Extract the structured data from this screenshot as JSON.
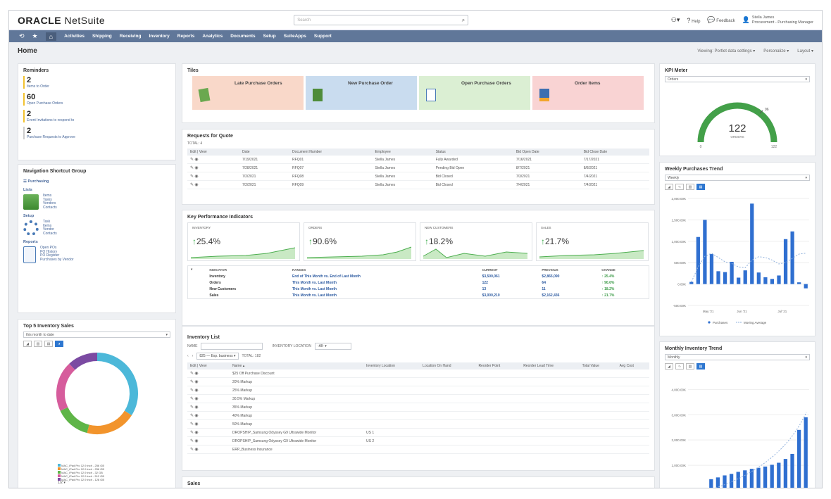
{
  "header": {
    "logo_brand": "ORACLE",
    "logo_product": "NetSuite",
    "search_placeholder": "Search",
    "help_label": "Help",
    "feedback_label": "Feedback",
    "user_name": "Stella James",
    "user_role": "Procurement - Purchasing Manager"
  },
  "nav": {
    "items": [
      "Activities",
      "Shipping",
      "Receiving",
      "Inventory",
      "Reports",
      "Analytics",
      "Documents",
      "Setup",
      "SuiteApps",
      "Support"
    ]
  },
  "page": {
    "title": "Home",
    "viewing": "Viewing: Portlet data settings ▾",
    "personalize": "Personalize ▾",
    "layout": "Layout ▾"
  },
  "reminders": {
    "title": "Reminders",
    "items": [
      {
        "count": "2",
        "label": "Items to Order"
      },
      {
        "count": "60",
        "label": "Open Purchase Orders"
      },
      {
        "count": "2",
        "label": "Event Invitations to respond to"
      },
      {
        "count": "2",
        "label": "Purchase Requests to Approve"
      }
    ]
  },
  "navgroup": {
    "title": "Navigation Shortcut Group",
    "group_label": "Purchasing",
    "sections": [
      {
        "name": "Lists",
        "links": [
          "Items",
          "Tasks",
          "Vendors",
          "Contacts"
        ]
      },
      {
        "name": "Setup",
        "links": [
          "Task",
          "Items",
          "Vendor",
          "Contacts"
        ]
      },
      {
        "name": "Reports",
        "links": [
          "Open POs",
          "PO History",
          "PO Register",
          "Purchases by Vendor"
        ]
      }
    ]
  },
  "top5": {
    "title": "Top 5 Inventory Sales",
    "period": "this month to date",
    "legend": [
      "MAC_iPad Pro 12.9 inch - 256 GB",
      "MAC_iPad Pro 12.9 inch - 256 GB",
      "MAC_iPad Pro 12.9 inch - 32 GB",
      "MAC_iPad Pro 12.9 inch - 512 GB",
      "MAC_iPad Pro 12.9 inch - 128 GB"
    ],
    "pager": "1/2 ▾",
    "colors": [
      "#4cb8d9",
      "#f2942c",
      "#5fb548",
      "#d65c9c",
      "#7b4aa2"
    ]
  },
  "tiles": {
    "title": "Tiles",
    "items": [
      {
        "label": "Late Purchase Orders",
        "bg": "#f9d8c9"
      },
      {
        "label": "New Purchase Order",
        "bg": "#c9dcef"
      },
      {
        "label": "Open Purchase Orders",
        "bg": "#dbefd3"
      },
      {
        "label": "Order Items",
        "bg": "#f9d3d3"
      }
    ]
  },
  "rfq": {
    "title": "Requests for Quote",
    "total": "TOTAL: 4",
    "columns": [
      "Edit | View",
      "Date",
      "Document Number",
      "Employee",
      "Status",
      "Bid Open Date",
      "Bid Close Date"
    ],
    "rows": [
      [
        "7/19/2021",
        "RFQ01",
        "Stella James",
        "Fully Awarded",
        "7/16/2021",
        "7/17/2021"
      ],
      [
        "7/28/2021",
        "RFQ07",
        "Stella James",
        "Pending Bid Open",
        "8/7/2021",
        "8/8/2021"
      ],
      [
        "7/2/2021",
        "RFQ08",
        "Stella James",
        "Bid Closed",
        "7/3/2021",
        "7/4/2021"
      ],
      [
        "7/2/2021",
        "RFQ09",
        "Stella James",
        "Bid Closed",
        "7/4/2021",
        "7/4/2021"
      ]
    ]
  },
  "kpi": {
    "title": "Key Performance Indicators",
    "cards": [
      {
        "label": "INVENTORY",
        "value": "25.4%"
      },
      {
        "label": "ORDERS",
        "value": "90.6%"
      },
      {
        "label": "NEW CUSTOMERS",
        "value": "18.2%"
      },
      {
        "label": "SALES",
        "value": "21.7%"
      }
    ],
    "columns": [
      "INDICATOR",
      "RANGES",
      "CURRENT",
      "PREVIOUS",
      "CHANGE"
    ],
    "rows": [
      [
        "Inventory",
        "End of This Month vs. End of Last Month",
        "$3,500,061",
        "$2,865,090",
        "25.4%"
      ],
      [
        "Orders",
        "This Month vs. Last Month",
        "122",
        "64",
        "90.6%"
      ],
      [
        "New Customers",
        "This Month vs. Last Month",
        "13",
        "11",
        "18.2%"
      ],
      [
        "Sales",
        "This Month vs. Last Month",
        "$3,000,210",
        "$2,162,436",
        "21.7%"
      ]
    ]
  },
  "inventory": {
    "title": "Inventory List",
    "name_label": "NAME",
    "location_label": "INVENTORY LOCATION",
    "location_value": "-All-",
    "range": "825 — Exp. business ▾",
    "total": "TOTAL: 182",
    "columns": [
      "Edit | View",
      "Name ▴",
      "Inventory Location",
      "Location On Hand",
      "Reorder Point",
      "Reorder Lead Time",
      "Total Value",
      "Avg Cost"
    ],
    "rows": [
      [
        "$25 Off Purchase Discount",
        ""
      ],
      [
        "20% Markup",
        ""
      ],
      [
        "25% Markup",
        ""
      ],
      [
        "30.5% Markup",
        ""
      ],
      [
        "35% Markup",
        ""
      ],
      [
        "40% Markup",
        ""
      ],
      [
        "50% Markup",
        ""
      ],
      [
        "DROPSHIP_Samsung Odyssey G9 Ultrawide Monitor",
        "US 1"
      ],
      [
        "DROPSHIP_Samsung Odyssey G9 Ultrawide Monitor",
        "US 2"
      ],
      [
        "ERP_Business Insurance",
        ""
      ]
    ]
  },
  "sales": {
    "title": "Sales"
  },
  "kpimeter": {
    "title": "KPI Meter",
    "select": "Orders",
    "value": "122",
    "unit": "ORDERS",
    "min": "0",
    "max": "122",
    "target": "96"
  },
  "weekly": {
    "title": "Weekly Purchases Trend",
    "select": "Weekly",
    "legend_purchases": "Purchases",
    "legend_moving": "Moving Average",
    "yticks": [
      "2,000.00K",
      "1,500.00K",
      "1,000.00K",
      "500.00K",
      "0.00K",
      "-500.00K"
    ],
    "xticks": [
      "May '21",
      "Jun '21",
      "Jul '21"
    ]
  },
  "monthly": {
    "title": "Monthly Inventory Trend",
    "select": "Monthly",
    "yticks": [
      "4,000.00K",
      "3,000.00K",
      "2,000.00K",
      "1,000.00K"
    ]
  },
  "chart_data": [
    {
      "type": "pie",
      "title": "Top 5 Inventory Sales",
      "categories": [
        "MAC_iPad Pro 12.9 inch - 256 GB",
        "MAC_iPad Pro 12.9 inch - 256 GB",
        "MAC_iPad Pro 12.9 inch - 32 GB",
        "MAC_iPad Pro 12.9 inch - 512 GB",
        "MAC_iPad Pro 12.9 inch - 128 GB"
      ],
      "values": [
        34,
        20,
        14,
        20,
        12
      ]
    },
    {
      "type": "bar",
      "title": "Weekly Purchases Trend",
      "ylim": [
        -500,
        2000
      ],
      "series": [
        {
          "name": "Purchases",
          "values": [
            50,
            1100,
            1500,
            700,
            300,
            280,
            520,
            150,
            320,
            1880,
            270,
            160,
            120,
            200,
            1050,
            1230,
            40,
            -100
          ]
        },
        {
          "name": "Moving Average",
          "values": [
            50,
            400,
            650,
            720,
            620,
            520,
            480,
            400,
            380,
            560,
            640,
            620,
            560,
            470,
            500,
            600,
            700,
            720
          ]
        }
      ]
    },
    {
      "type": "bar",
      "title": "Monthly Inventory Trend",
      "series": [
        {
          "name": "Inventory",
          "values": [
            450,
            520,
            600,
            660,
            740,
            800,
            860,
            900,
            950,
            1020,
            1100,
            1250,
            1450,
            2400,
            2900
          ]
        }
      ]
    }
  ]
}
